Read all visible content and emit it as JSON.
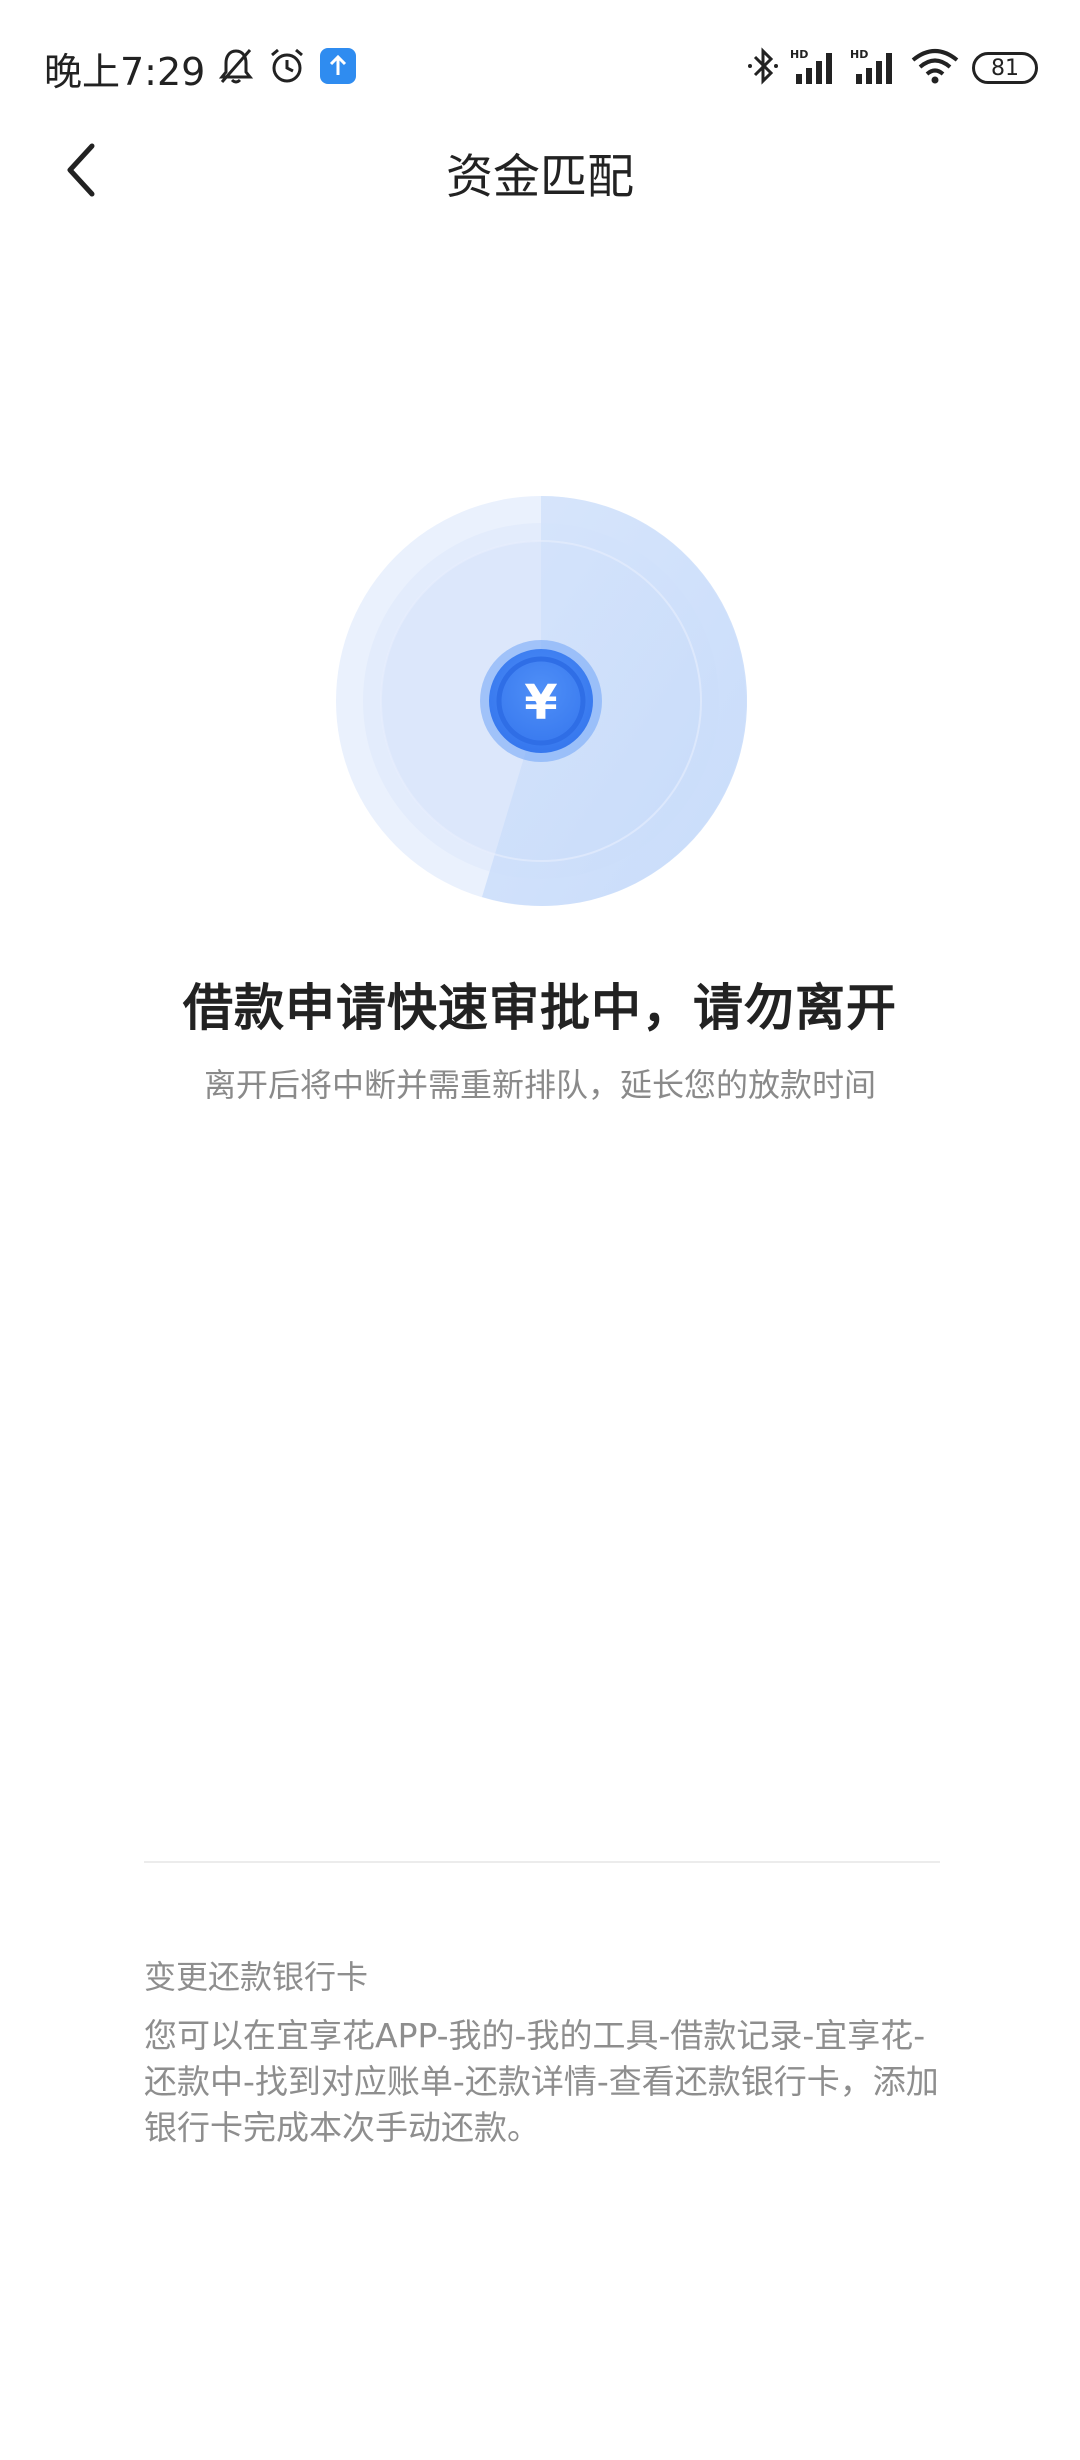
{
  "status_bar": {
    "time": "晚上7:29",
    "battery": "81",
    "icons": [
      "mute-bell-icon",
      "alarm-icon",
      "upload-app-icon",
      "bluetooth-icon",
      "signal-hd-icon",
      "signal-hd-icon",
      "wifi-icon",
      "battery-icon"
    ],
    "hd_label": "HD"
  },
  "nav": {
    "title": "资金匹配",
    "back_icon": "chevron-left-icon"
  },
  "radar": {
    "symbol": "¥",
    "accent": "#3d7ff2"
  },
  "main": {
    "headline": "借款申请快速审批中，请勿离开",
    "subline": "离开后将中断并需重新排队，延长您的放款时间"
  },
  "info": {
    "title": "变更还款银行卡",
    "body": "您可以在宜享花APP-我的-我的工具-借款记录-宜享花-还款中-找到对应账单-还款详情-查看还款银行卡，添加银行卡完成本次手动还款。"
  }
}
